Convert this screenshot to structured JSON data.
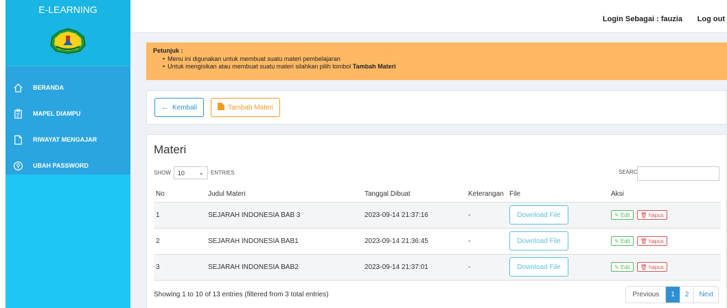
{
  "sidebar": {
    "brand": "E-LEARNING",
    "items": [
      {
        "label": "BERANDA",
        "icon": "home-icon"
      },
      {
        "label": "MAPEL DIAMPU",
        "icon": "clipboard-icon"
      },
      {
        "label": "RIWAYAT MENGAJAR",
        "icon": "file-icon"
      },
      {
        "label": "UBAH PASSWORD",
        "icon": "key-icon"
      }
    ]
  },
  "topbar": {
    "login_text": "Login Sebagai : fauzia",
    "logout_label": "Log out"
  },
  "alert": {
    "title": "Petunjuk :",
    "line1": "Menu ini digunakan untuk membuat suatu materi pembelajaran",
    "line2_prefix": "Untuk mengisikan atau membuat suatu materi silahkan pilih tombol ",
    "line2_bold": "Tambah Materi"
  },
  "buttons": {
    "back": "Kembali",
    "add": "Tambah Materi"
  },
  "table": {
    "title": "Materi",
    "show_label": "SHOW",
    "entries_value": "10",
    "entries_label": "ENTRIES",
    "search_label": "SEARCH:",
    "search_value": "",
    "columns": [
      "No",
      "Judul Materi",
      "Tanggal Dibuat",
      "Keterangan",
      "File",
      "Aksi"
    ],
    "rows": [
      {
        "no": "1",
        "judul": "SEJARAH INDONESIA BAB 3",
        "tanggal": "2023-09-14 21:37:16",
        "keterangan": "-",
        "file": "Download File",
        "edit": "Edit",
        "hapus": "hapus"
      },
      {
        "no": "2",
        "judul": "SEJARAH INDONESIA BAB1",
        "tanggal": "2023-09-14 21:36:45",
        "keterangan": "-",
        "file": "Download File",
        "edit": "Edit",
        "hapus": "hapus"
      },
      {
        "no": "3",
        "judul": "SEJARAH INDONESIA BAB2",
        "tanggal": "2023-09-14 21:37:01",
        "keterangan": "-",
        "file": "Download File",
        "edit": "Edit",
        "hapus": "hapus"
      }
    ],
    "info": "Showing 1 to 10 of 13 entries (filtered from 3 total entries)",
    "pagination": {
      "previous": "Previous",
      "pages": [
        "1",
        "2"
      ],
      "current": "1",
      "next": "Next"
    }
  },
  "colors": {
    "sidebar": "#1ec6f5",
    "menu": "#2aa5df",
    "alert": "#ffb864",
    "primary": "#2f8fd3",
    "warning": "#f29b21",
    "info": "#5bc0de",
    "success": "#5cb85c",
    "danger": "#d9534f"
  }
}
